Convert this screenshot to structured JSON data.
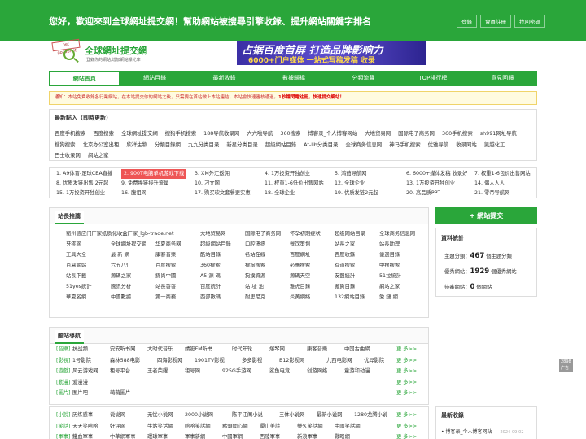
{
  "header": {
    "welcome": "您好，歡迎來到全球網址提交網！幫助網站被搜尋引擎收錄、提升網站關鍵字排名",
    "buttons": [
      "登錄",
      "會員註冊",
      "找回密碼"
    ]
  },
  "logo": {
    "badge": "net gosubmit",
    "title": "全球網址提交網",
    "subtitle": "登錄你的網站,增加網站曝光率"
  },
  "banner": {
    "main": "占据百度首屏 打造品牌影响力",
    "sub": "6000+门户媒体 一站式写稿发稿 收录"
  },
  "nav": {
    "items": [
      "網站首頁",
      "網站目錄",
      "最新收錄",
      "數據歸檔",
      "分類流覽",
      "TOP排行榜",
      "意見回饋"
    ],
    "active": 0
  },
  "notice": {
    "text": "通知：本站免費收錄各行業網站，在本站提交你的網站之後，只需要在首站做上本站連結，本站會快速審核通過。",
    "highlight": "1秒鐘閃電註冊，快速提交網站！"
  },
  "latest": {
    "title": "最新點入（即時更新）",
    "links": [
      "百度手机搜索",
      "百度搜索",
      "全球網址提交網",
      "搜狗手机搜索",
      "188导航收录网",
      "六六啦导航",
      "360搜索",
      "博客录_个人博客网站",
      "大地贸易网",
      "国际电子商务网",
      "360手机搜索",
      "sh991网址导航",
      "搜狗搜索",
      "北京办公室出租",
      "欣祥生物",
      "分類目錄網",
      "九九分类目录",
      "新星分类目录",
      "超級網站目錄",
      "At-lib分类目录",
      "全球商务信息网",
      "神马手机搜索",
      "优雅导航",
      "收录网站",
      "凯越化工",
      "巴士收录网",
      "網站之家"
    ]
  },
  "rank": {
    "rows": [
      [
        "1. A9体育-足球CBA直播",
        "2. 900T电脑单机游戏下载",
        "3. XM外汇返佣",
        "4. 1万投资开独创业",
        "5. 鸿茹导航网",
        "6. 6000+媒体发稿 收录好",
        "7. 权重1-6包价出售网站"
      ],
      [
        "8. 优质发链出售 2元起",
        "9. 免费换链接升流量",
        "10. 刁文网",
        "11. 权重1-6低价出售网站",
        "12. 全球企业",
        "13. 1万投资开独创业",
        "14. 偶人人人"
      ],
      [
        "15. 1万投资开独创业",
        "16. 腹诅网",
        "17. 购买软文套餐更实惠",
        "18. 全球企业",
        "19. 优质发链2元起",
        "20. 高品质PPT",
        "21. 零帝导航网"
      ]
    ],
    "hot_index": 1,
    "ad_tag": "2898广告"
  },
  "sites": {
    "title": "站長推薦",
    "items": [
      "衢州感应门厂家纸质化收盒厂家_lgb-trade.net",
      "",
      "",
      "大地贸易网",
      "国际电子商务网",
      "怀孕初期症状",
      "超级网站目录",
      "全球商务信息网",
      "牙疼网",
      "全球網址提交網",
      "华夏商务网",
      "超級網站目錄",
      "口腔溃疡",
      "餐饮策划",
      "站長之家",
      "站長助理",
      "工具大全",
      "最 新 網",
      "康客音樂",
      "酷站目錄",
      "名站在線",
      "百度網址",
      "百度收錄",
      "優選目錄",
      "百寫網站",
      "六五八仁",
      "百度搜索",
      "360搜索",
      "搜狗搜索",
      "必應搜索",
      "有道搜索",
      "中搜搜索",
      "站長下載",
      "源碼之家",
      "錦尚中國",
      "A5 源 碼",
      "狗撲資源",
      "源碼天空",
      "友盟統計",
      "51拉統計",
      "51yes統計",
      "騰訊分析",
      "站長發發",
      "百度統計",
      "站 址 池",
      "雅虎目錄",
      "搬貨目錄",
      "網站之家",
      "華夏名網",
      "中國數據",
      "第一商務",
      "西部數碼",
      "耐思尼克",
      "炎黃網絡",
      "132網站目錄",
      "愛 鏈 網"
    ]
  },
  "cats": {
    "title": "酷站導航",
    "more": "更 多>>",
    "rows": [
      {
        "label": "[音樂]",
        "links": [
          "抗战频",
          "安安听书网",
          "大时代音乐",
          "蜻蜓FM听书",
          "时代年轮",
          "爆琴网",
          "康客音樂",
          "中国古曲網"
        ]
      },
      {
        "label": "[影視]",
        "links": [
          "1号影院",
          "森林588电影",
          "四海影视网",
          "1901TV影视",
          "多多影视",
          "B12影视网",
          "九西电影网",
          "优异影院"
        ]
      },
      {
        "label": "[遊戲]",
        "links": [
          "风云游戏网",
          "租号平台",
          "王者荣耀",
          "租号网",
          "925G手游网",
          "鲨鱼电竞",
          "创游网络",
          "童游和动漫"
        ]
      },
      {
        "label": "[動漫]",
        "links": [
          "爱漫漫"
        ]
      },
      {
        "label": "[圖片]",
        "links": [
          "图片吧",
          "萌萌圖片"
        ]
      }
    ],
    "rows2": [
      {
        "label": "[小說]",
        "links": [
          "历练感事",
          "说说网",
          "无忧小说网",
          "2000小说网",
          "陈平江阁小说",
          "三体小说网",
          "最新小说网",
          "1280龙腾小说"
        ]
      },
      {
        "label": "[笑話]",
        "links": [
          "天天笑哈哈",
          "好评网",
          "牛站笑话網",
          "哈哈笑話網",
          "豬頭開心網",
          "優山美詩",
          "樂久笑話網",
          "中國笑話網"
        ]
      },
      {
        "label": "[軍事]",
        "links": [
          "鐵血軍事",
          "中華網軍事",
          "環球軍事",
          "軍事新網",
          "中國軍網",
          "西陸軍事",
          "新浪軍事",
          "戰略網"
        ]
      }
    ]
  },
  "sidebar": {
    "submit_label": "+ 網站提交",
    "stats_title": "資料統計",
    "stats": [
      {
        "label": "主題分類：",
        "value": "467",
        "unit": "個主題分類"
      },
      {
        "label": "優秀網站：",
        "value": "1929",
        "unit": "個優秀網站"
      },
      {
        "label": "待審網站：",
        "value": "0",
        "unit": "個網站"
      }
    ],
    "news_title": "最新收錄",
    "news": [
      {
        "text": "博客录_个人博客网站",
        "date": "2024-09-02"
      }
    ]
  }
}
